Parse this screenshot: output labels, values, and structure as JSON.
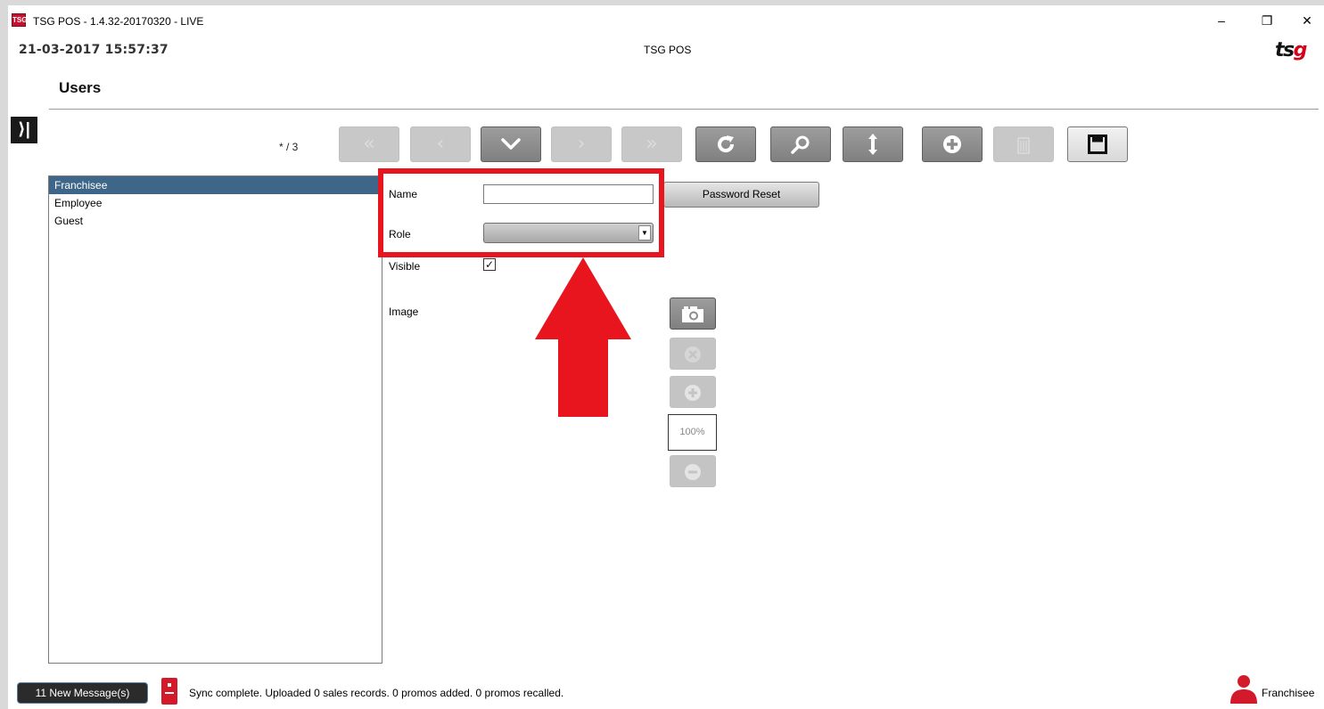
{
  "window": {
    "title": "TSG POS - 1.4.32-20170320 - LIVE",
    "icon_label": "TSG",
    "controls": {
      "minimize": "–",
      "maximize": "❐",
      "close": "✕"
    }
  },
  "header": {
    "datetime": "21-03-2017 15:57:37",
    "center_title": "TSG POS",
    "logo_main": "ts",
    "logo_accent": "g",
    "page_title": "Users"
  },
  "sidebar_toggle": {
    "glyph": "⟩|",
    "icon": "expand-sidebar-icon"
  },
  "record_counter": "* / 3",
  "toolbar": {
    "buttons": [
      {
        "name": "first-record-button",
        "icon": "double-chevron-left-icon",
        "glyph": "«",
        "enabled": false
      },
      {
        "name": "previous-record-button",
        "icon": "chevron-left-icon",
        "glyph": "‹",
        "enabled": false
      },
      {
        "name": "dropdown-record-button",
        "icon": "chevron-down-icon",
        "glyph": "⌄",
        "enabled": true
      },
      {
        "name": "next-record-button",
        "icon": "chevron-right-icon",
        "glyph": "›",
        "enabled": false
      },
      {
        "name": "last-record-button",
        "icon": "double-chevron-right-icon",
        "glyph": "»",
        "enabled": false
      },
      {
        "name": "refresh-button",
        "icon": "refresh-icon",
        "glyph": "↻",
        "enabled": true
      },
      {
        "name": "search-button",
        "icon": "search-icon",
        "glyph": "⚲",
        "enabled": true
      },
      {
        "name": "sort-button",
        "icon": "vertical-arrows-icon",
        "glyph": "↕",
        "enabled": true
      },
      {
        "name": "add-button",
        "icon": "plus-circle-icon",
        "glyph": "+",
        "enabled": true
      },
      {
        "name": "delete-button",
        "icon": "trash-icon",
        "glyph": "▥",
        "enabled": false
      },
      {
        "name": "save-button",
        "icon": "floppy-disk-icon",
        "glyph": "▣",
        "enabled": true
      }
    ]
  },
  "role_list": {
    "items": [
      "Franchisee",
      "Employee",
      "Guest"
    ],
    "selected_index": 0
  },
  "form": {
    "name_label": "Name",
    "name_value": "",
    "role_label": "Role",
    "role_value": "",
    "visible_label": "Visible",
    "visible_checked": true,
    "image_label": "Image",
    "password_reset_label": "Password Reset",
    "zoom_value": "100%"
  },
  "image_tools": [
    {
      "name": "camera-button",
      "icon": "camera-icon",
      "enabled": true
    },
    {
      "name": "remove-image-button",
      "icon": "cancel-circle-icon",
      "enabled": false
    },
    {
      "name": "zoom-in-button",
      "icon": "plus-circle-icon",
      "enabled": false
    },
    {
      "name": "zoom-out-button",
      "icon": "minus-circle-icon",
      "enabled": false
    }
  ],
  "footer": {
    "messages_label": "11 New Message(s)",
    "sync_status": "Sync complete.  Uploaded 0 sales records. 0 promos added. 0 promos recalled.",
    "current_user": "Franchisee"
  },
  "colors": {
    "accent_red": "#e8141e",
    "selected_row": "#3d6688",
    "toolbar_active": "#8c8c8c",
    "toolbar_disabled": "#c8c8c8"
  }
}
